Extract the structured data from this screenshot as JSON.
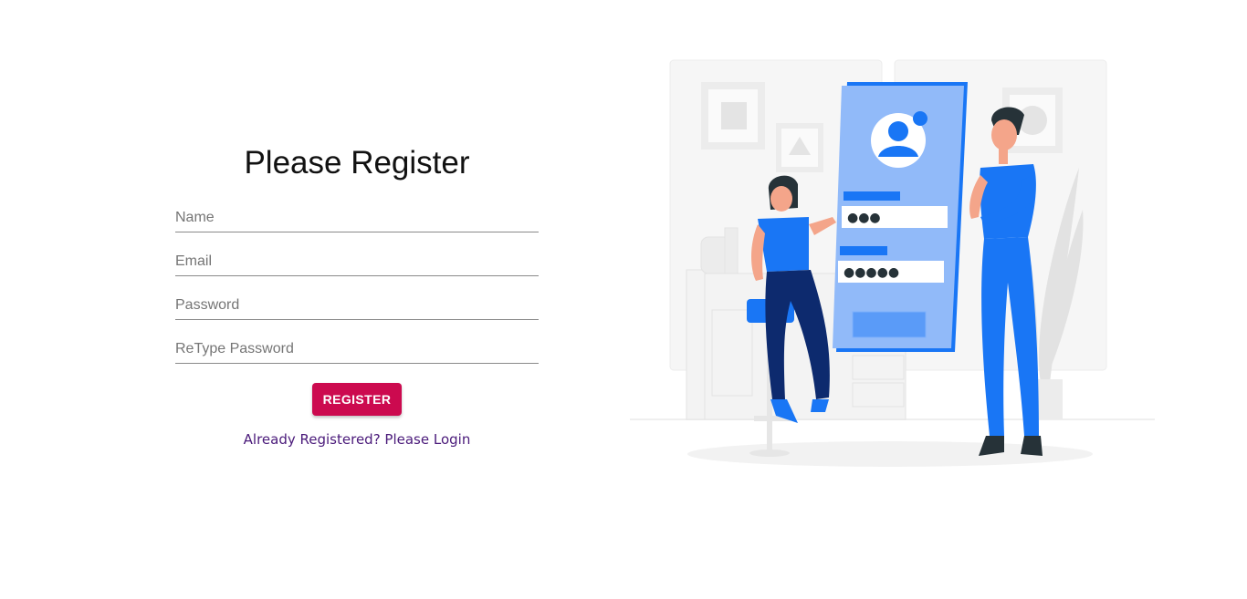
{
  "form": {
    "title": "Please Register",
    "fields": [
      {
        "placeholder": "Name",
        "value": ""
      },
      {
        "placeholder": "Email",
        "value": ""
      },
      {
        "placeholder": "Password",
        "value": ""
      },
      {
        "placeholder": "ReType Password",
        "value": ""
      }
    ],
    "register_label": "REGISTER",
    "login_link": "Already Registered? Please Login"
  },
  "illustration": {
    "name": "registration-illustration",
    "masked_password_short": "●●●",
    "masked_password_long": "●●●●●"
  },
  "colors": {
    "accent": "#cc0a4f",
    "link": "#4a1a7a",
    "illustration_blue": "#1976f5",
    "illustration_light_blue": "#91baf9"
  }
}
